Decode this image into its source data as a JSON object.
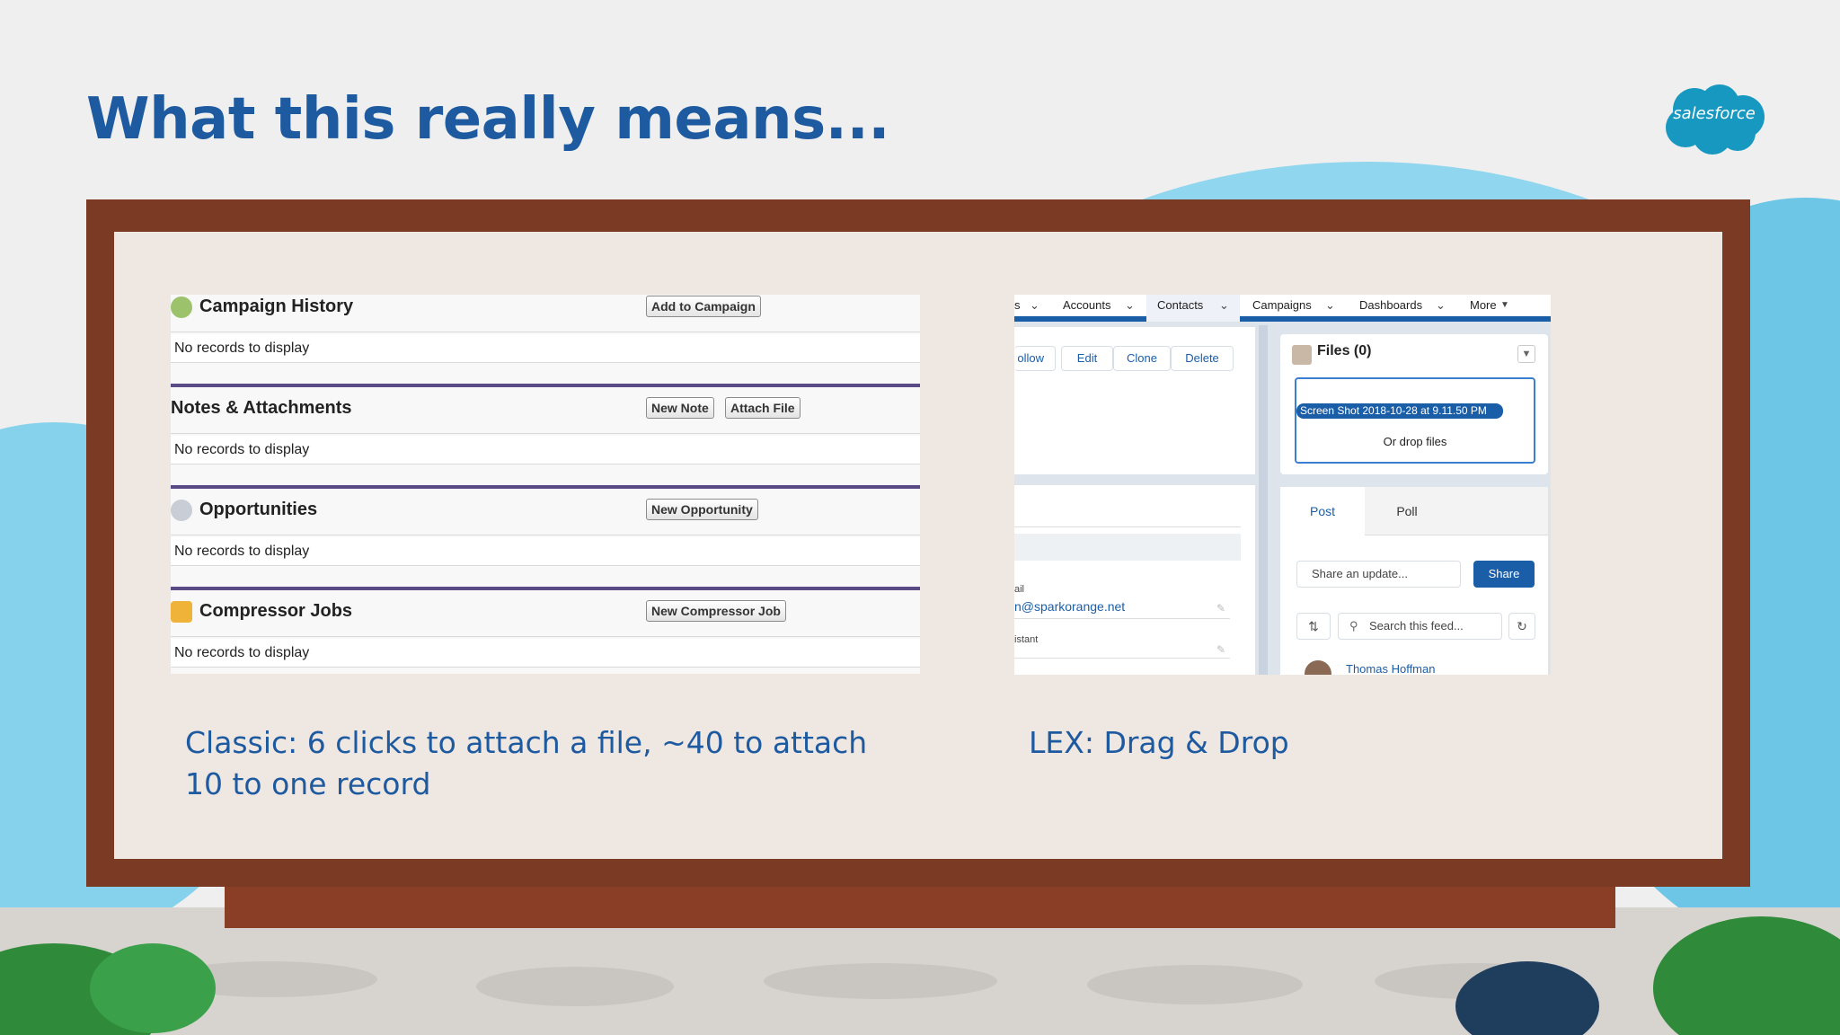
{
  "slide": {
    "title": "What this really means...",
    "logo_text": "salesforce"
  },
  "classic": {
    "sections": [
      {
        "title": "Campaign History",
        "buttons": [
          "Add to Campaign"
        ],
        "empty_text": "No records to display"
      },
      {
        "title": "Notes & Attachments",
        "buttons": [
          "New Note",
          "Attach File"
        ],
        "empty_text": "No records to display"
      },
      {
        "title": "Opportunities",
        "buttons": [
          "New Opportunity"
        ],
        "empty_text": "No records to display"
      },
      {
        "title": "Compressor Jobs",
        "buttons": [
          "New Compressor Job"
        ],
        "empty_text": "No records to display"
      }
    ]
  },
  "lex": {
    "nav": {
      "items": [
        "s",
        "Accounts",
        "Contacts",
        "Campaigns",
        "Dashboards",
        "More"
      ],
      "active": "Contacts"
    },
    "record_actions": [
      "ollow",
      "Edit",
      "Clone",
      "Delete"
    ],
    "fields": {
      "email_label": "ail",
      "email_value": "n@sparkorange.net",
      "assistant_label": "istant"
    },
    "files": {
      "title": "Files (0)",
      "dragged_file": "Screen Shot 2018-10-28 at 9.11.50 PM",
      "drop_text": "Or drop files"
    },
    "feed": {
      "tabs": [
        "Post",
        "Poll"
      ],
      "share_placeholder": "Share an update...",
      "share_button": "Share",
      "search_placeholder": "Search this feed...",
      "first_user": "Thomas Hoffman"
    }
  },
  "captions": {
    "classic": "Classic: 6 clicks to attach a file, ~40 to attach 10 to one record",
    "lex": "LEX: Drag & Drop"
  },
  "colors": {
    "title_blue": "#1e5aa0",
    "frame_brown": "#7a3a24",
    "board_face": "#efe7e2",
    "sky_blue": "#8fd6ee",
    "lex_brand": "#1b5ea8"
  }
}
